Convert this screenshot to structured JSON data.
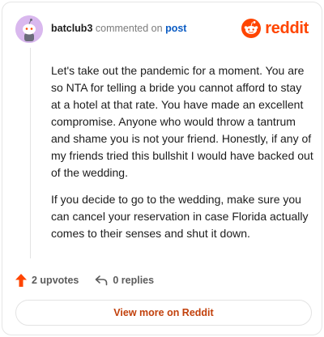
{
  "header": {
    "author": "batclub3",
    "action": "commented on",
    "post_link": "post",
    "avatar_icon": "snoo-avatar-icon",
    "brand_icon": "reddit-logo-icon",
    "brand_name": "reddit"
  },
  "comment": {
    "paragraphs": [
      "Let's take out the pandemic for a moment. You are so NTA for telling a bride you cannot afford to stay at a hotel at that rate. You have made an excellent compromise. Anyone who would throw a tantrum and shame you is not your friend. Honestly, if any of my friends tried this bullshit I would have backed out of the wedding.",
      "If you decide to go to the wedding, make sure you can cancel your reservation in case Florida actually comes to their senses and shut it down."
    ]
  },
  "footer": {
    "upvotes": "2 upvotes",
    "upvote_icon": "upvote-arrow-icon",
    "replies": "0 replies",
    "reply_icon": "reply-arrow-icon"
  },
  "view_more": "View more on Reddit",
  "colors": {
    "brand": "#ff4500",
    "link": "#0b5cc4",
    "view_more_text": "#c2410c",
    "avatar_bg": "#d9b8ee"
  }
}
